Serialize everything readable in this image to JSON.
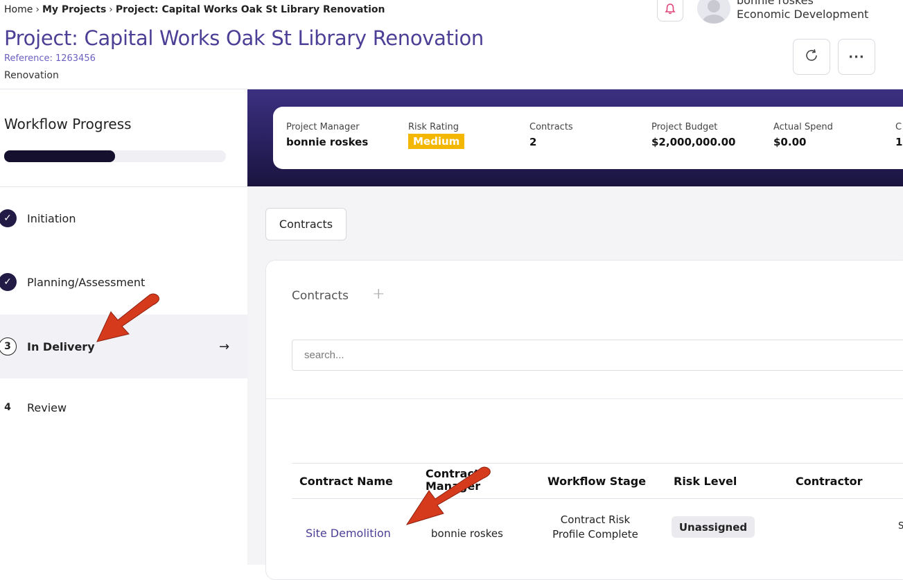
{
  "breadcrumb": {
    "home": "Home",
    "sep1": "›",
    "my_projects": "My Projects",
    "sep2": "›",
    "current": "Project: Capital Works Oak St Library Renovation"
  },
  "header": {
    "title": "Project: Capital Works Oak St Library Renovation",
    "reference": "Reference: 1263456",
    "type": "Renovation",
    "more_label": "···"
  },
  "user": {
    "name": "bonnie roskes",
    "department": "Economic Development"
  },
  "sidebar": {
    "title": "Workflow Progress",
    "progress": 0.5,
    "steps": [
      {
        "marker": "✓",
        "label": "Initiation",
        "state": "done"
      },
      {
        "marker": "✓",
        "label": "Planning/Assessment",
        "state": "done"
      },
      {
        "marker": "3",
        "label": "In Delivery",
        "state": "active",
        "arrow": "→"
      },
      {
        "marker": "4",
        "label": "Review",
        "state": "pending"
      }
    ]
  },
  "stats": {
    "project_manager_label": "Project Manager",
    "project_manager": "bonnie roskes",
    "risk_rating_label": "Risk Rating",
    "risk_rating": "Medium",
    "contracts_label": "Contracts",
    "contracts": "2",
    "budget_label": "Project Budget",
    "budget": "$2,000,000.00",
    "spend_label": "Actual Spend",
    "spend": "$0.00",
    "cut_label": "C",
    "cut_value": "1"
  },
  "tabs": {
    "contracts": "Contracts"
  },
  "contracts_panel": {
    "title": "Contracts",
    "add_icon": "+",
    "search_placeholder": "search...",
    "columns": [
      "Contract Name",
      "Contract Manager",
      "Workflow Stage",
      "Risk Level",
      "Contractor"
    ],
    "rows": [
      {
        "name": "Site Demolition",
        "manager": "bonnie roskes",
        "stage": "Contract Risk Profile Complete",
        "risk": "Unassigned",
        "trailing": "S"
      }
    ]
  },
  "colors": {
    "accent": "#4b3f96",
    "banner": "#2a2262",
    "risk_medium": "#f3b700",
    "annotation_arrow": "#d63a1c"
  }
}
